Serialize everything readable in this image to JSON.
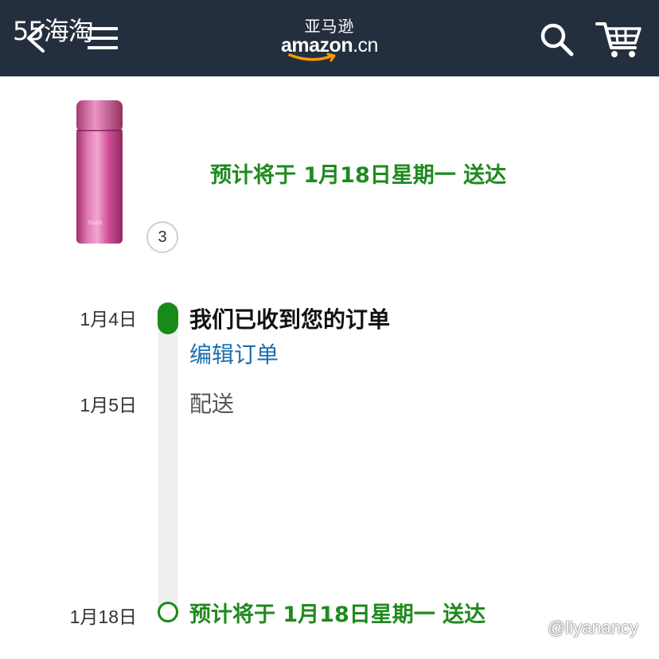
{
  "watermarks": {
    "top": "55海淘",
    "bottom": "@liyanancy"
  },
  "header": {
    "logo_cn": "亚马逊",
    "logo_main": "amazon",
    "logo_suffix": ".cn",
    "icons": [
      "back-icon",
      "menu-icon",
      "search-icon",
      "cart-icon"
    ],
    "background": "#232f3e"
  },
  "product": {
    "quantity": "3",
    "delivery_estimate": "预计将于 1月18日星期一 送达"
  },
  "timeline": {
    "steps": [
      {
        "date": "1月4日",
        "title": "我们已收到您的订单",
        "link": "编辑订单",
        "status": "done"
      },
      {
        "date": "1月5日",
        "title": "配送",
        "status": "pending"
      },
      {
        "date": "1月18日",
        "title": "预计将于 1月18日星期一 送达",
        "status": "estimated"
      }
    ]
  },
  "colors": {
    "accent_green": "#178a17",
    "link_blue": "#1a6fb0",
    "product_pink": "#d8569e"
  }
}
